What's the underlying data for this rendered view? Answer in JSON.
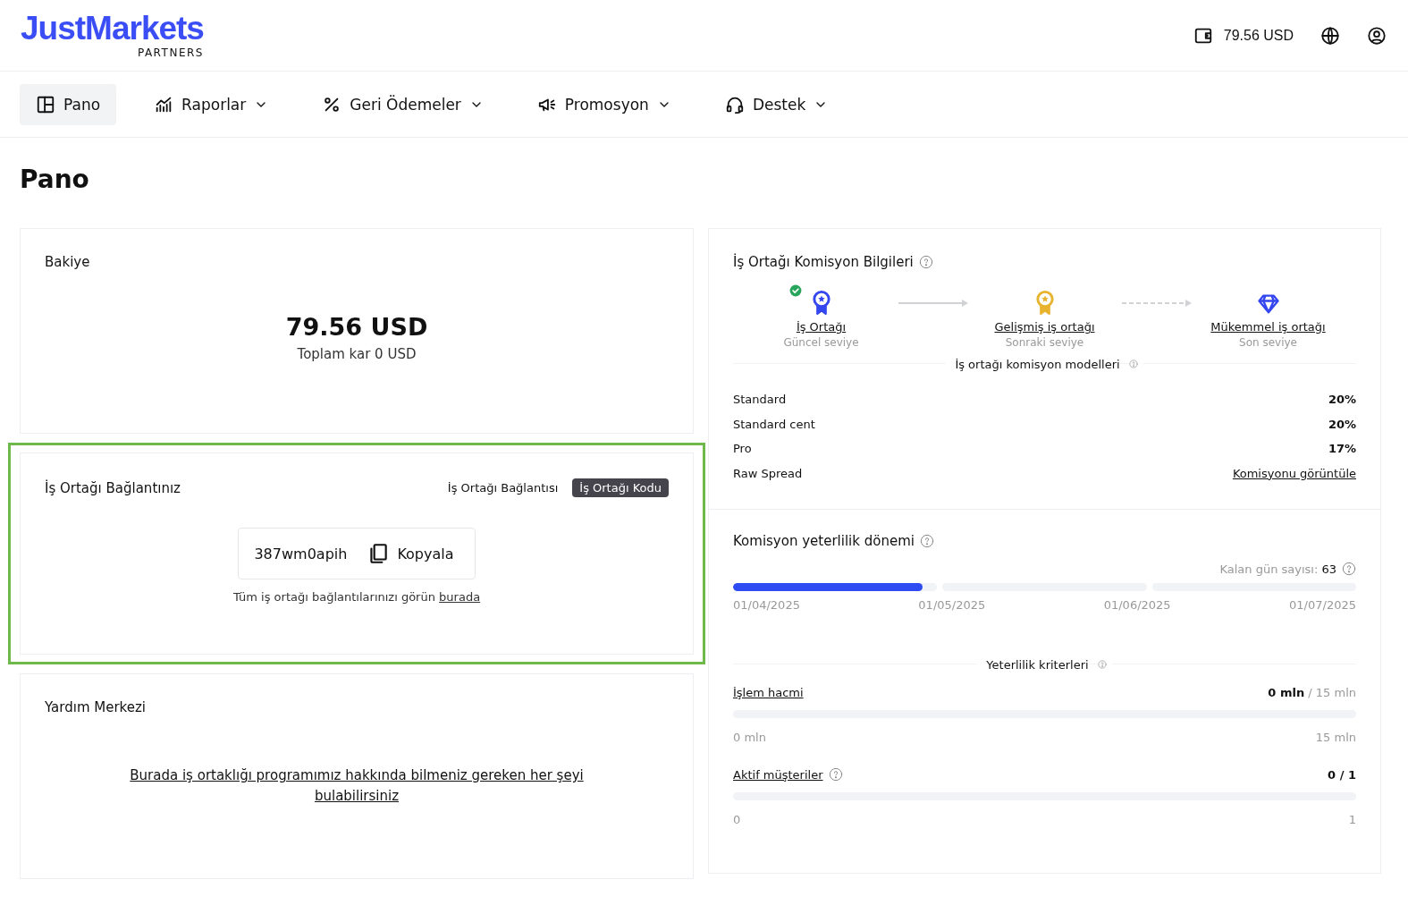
{
  "header": {
    "logo": "JustMarkets",
    "logo_sub": "PARTNERS",
    "balance": "79.56 USD"
  },
  "nav": [
    {
      "label": "Pano",
      "selected": true,
      "dropdown": false
    },
    {
      "label": "Raporlar",
      "selected": false,
      "dropdown": true
    },
    {
      "label": "Geri Ödemeler",
      "selected": false,
      "dropdown": true
    },
    {
      "label": "Promosyon",
      "selected": false,
      "dropdown": true
    },
    {
      "label": "Destek",
      "selected": false,
      "dropdown": true
    }
  ],
  "page_title": "Pano",
  "balance_card": {
    "title": "Bakiye",
    "amount": "79.56 USD",
    "subtitle": "Toplam kar 0 USD"
  },
  "link_card": {
    "title": "İş Ortağı Bağlantınız",
    "highlighted": true,
    "tabs": [
      {
        "label": "İş Ortağı Bağlantısı",
        "selected": false
      },
      {
        "label": "İş Ortağı Kodu",
        "selected": true
      }
    ],
    "code": "387wm0apih",
    "copy": "Kopyala",
    "note_text": "Tüm iş ortağı bağlantılarınızı görün",
    "note_link": "burada"
  },
  "help_card": {
    "title": "Yardım Merkezi",
    "link": "Burada iş ortaklığı programımız hakkında bilmeniz gereken her şeyi bulabilirsiniz"
  },
  "commission_card": {
    "title": "İş Ortağı Komisyon Bilgileri",
    "tiers": [
      {
        "kind": "rosette",
        "color": "#3346f0",
        "name": "İş Ortağı",
        "status": "Güncel seviye",
        "achieved": true
      },
      {
        "kind": "rosette",
        "color": "#e8b32e",
        "name": "Gelişmiş iş ortağı",
        "status": "Sonraki seviye",
        "achieved": false
      },
      {
        "kind": "diamond",
        "color": "#3346f0",
        "name": "Mükemmel iş ortağı",
        "status": "Son seviye",
        "achieved": false
      }
    ],
    "connectors": [
      {
        "kind": "solid"
      },
      {
        "kind": "dashed"
      }
    ],
    "models_title": "İş ortağı komisyon modelleri",
    "models": [
      {
        "name": "Standard",
        "value": "20%",
        "kind": "text"
      },
      {
        "name": "Standard cent",
        "value": "20%",
        "kind": "text"
      },
      {
        "name": "Pro",
        "value": "17%",
        "kind": "text"
      },
      {
        "name": "Raw Spread",
        "value": "Komisyonu görüntüle",
        "kind": "link"
      }
    ]
  },
  "period_card": {
    "title": "Komisyon yeterlilik dönemi",
    "days_label": "Kalan gün sayısı:",
    "days": "63",
    "segments": [
      {
        "level": 0.93
      },
      {
        "level": 0
      },
      {
        "level": 0
      }
    ],
    "dates": [
      "01/04/2025",
      "01/05/2025",
      "01/06/2025",
      "01/07/2025"
    ],
    "criteria_title": "Yeterlilik kriterleri",
    "criteria": [
      {
        "name": "İşlem hacmi",
        "help": false,
        "current": "0 mln",
        "target": "/ 15 mln",
        "level": 0,
        "min": "0 mln",
        "max": "15 mln"
      },
      {
        "name": "Aktif müşteriler",
        "help": true,
        "current": "0 / 1",
        "level": 0,
        "min": "0",
        "max": "1"
      }
    ]
  }
}
